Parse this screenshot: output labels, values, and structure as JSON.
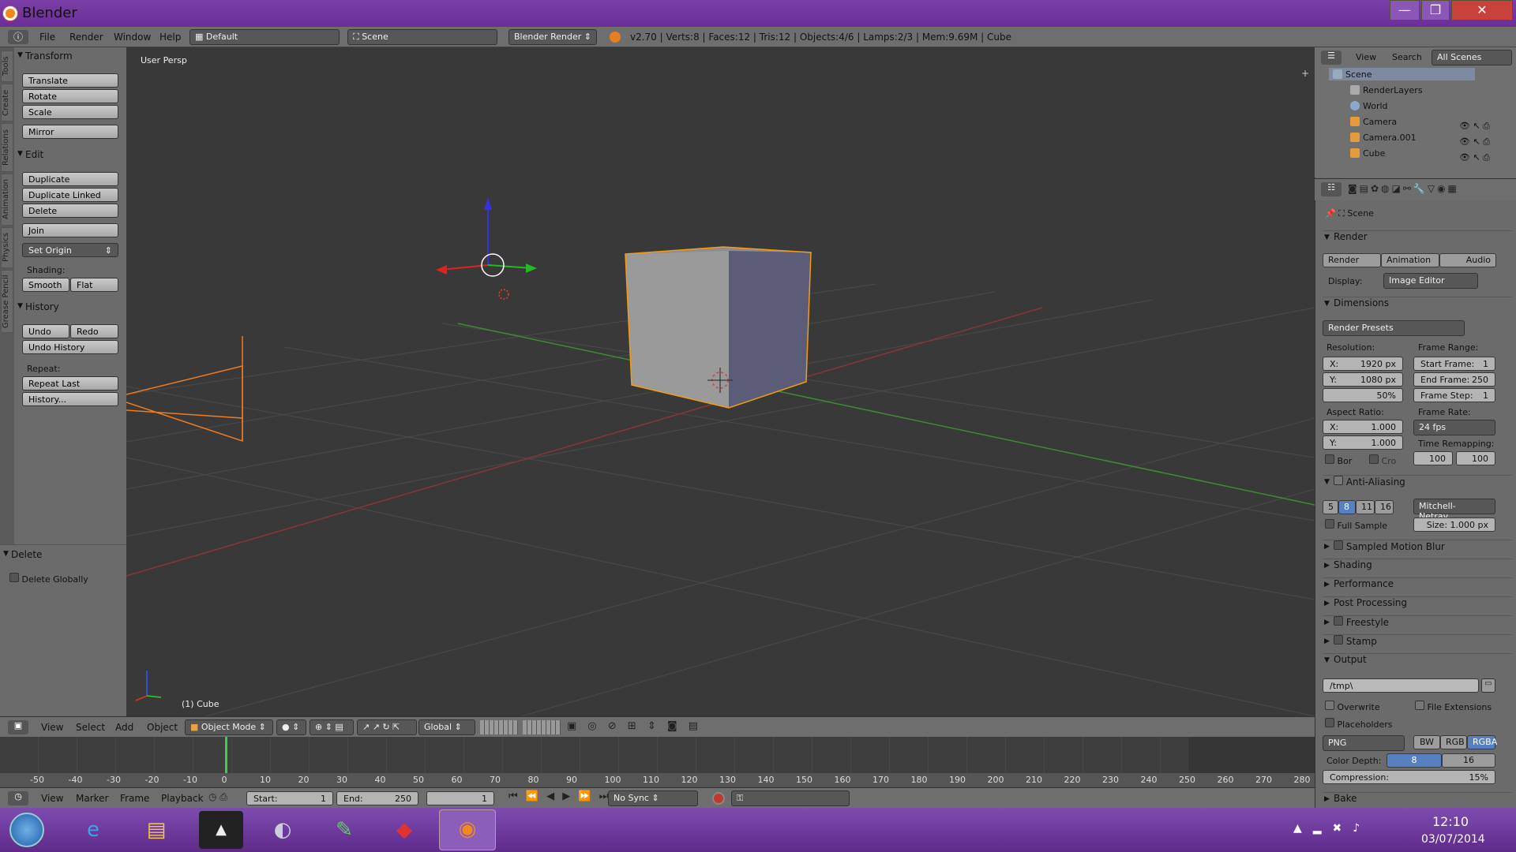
{
  "window": {
    "title": "Blender",
    "min": "—",
    "max": "❐",
    "close": "✕"
  },
  "info": {
    "menus": [
      "File",
      "Render",
      "Window",
      "Help"
    ],
    "screen_layout": "Default",
    "scene": "Scene",
    "engine": "Blender Render",
    "stats": "v2.70 | Verts:8 | Faces:12 | Tris:12 | Objects:4/6 | Lamps:2/3 | Mem:9.69M | Cube"
  },
  "tool_tabs": [
    "Tools",
    "Create",
    "Relations",
    "Animation",
    "Physics",
    "Grease Pencil"
  ],
  "toolshelf": {
    "transform": {
      "title": "Transform",
      "buttons": [
        "Translate",
        "Rotate",
        "Scale",
        "Mirror"
      ]
    },
    "edit": {
      "title": "Edit",
      "buttons": [
        "Duplicate",
        "Duplicate Linked",
        "Delete",
        "Join"
      ],
      "set_origin": "Set Origin",
      "shading_label": "Shading:",
      "smooth": "Smooth",
      "flat": "Flat"
    },
    "history": {
      "title": "History",
      "undo": "Undo",
      "redo": "Redo",
      "undo_history": "Undo History",
      "repeat_label": "Repeat:",
      "repeat_last": "Repeat Last",
      "history_btn": "History..."
    },
    "operator": {
      "title": "Delete",
      "delete_globally": "Delete Globally"
    }
  },
  "viewport": {
    "label": "User Persp",
    "object_label": "(1) Cube"
  },
  "vp_header": {
    "menus": [
      "View",
      "Select",
      "Add",
      "Object"
    ],
    "mode": "Object Mode",
    "orientation": "Global"
  },
  "timeline": {
    "ruler": [
      "-50",
      "-40",
      "-30",
      "-20",
      "-10",
      "0",
      "10",
      "20",
      "30",
      "40",
      "50",
      "60",
      "70",
      "80",
      "90",
      "100",
      "110",
      "120",
      "130",
      "140",
      "150",
      "160",
      "170",
      "180",
      "190",
      "200",
      "210",
      "220",
      "230",
      "240",
      "250",
      "260",
      "270",
      "280"
    ],
    "menus": [
      "View",
      "Marker",
      "Frame",
      "Playback"
    ],
    "start": "Start:",
    "start_val": "1",
    "end": "End:",
    "end_val": "250",
    "current": "1",
    "sync": "No Sync"
  },
  "outliner": {
    "menus": [
      "View",
      "Search"
    ],
    "filter": "All Scenes",
    "rows": [
      "Scene",
      "RenderLayers",
      "World",
      "Camera",
      "Camera.001",
      "Cube"
    ]
  },
  "properties": {
    "context": "Scene",
    "render": {
      "title": "Render",
      "render_btn": "Render",
      "animation_btn": "Animation",
      "audio_btn": "Audio",
      "display_label": "Display:",
      "display_val": "Image Editor"
    },
    "dimensions": {
      "title": "Dimensions",
      "presets": "Render Presets",
      "resolution_label": "Resolution:",
      "x": "X:",
      "x_val": "1920 px",
      "y": "Y:",
      "y_val": "1080 px",
      "percent": "50%",
      "frame_range_label": "Frame Range:",
      "start": "Start Frame:",
      "start_val": "1",
      "end": "End Frame:",
      "end_val": "250",
      "step": "Frame Step:",
      "step_val": "1",
      "aspect_label": "Aspect Ratio:",
      "ax_val": "1.000",
      "ay_val": "1.000",
      "framerate_label": "Frame Rate:",
      "fps": "24 fps",
      "remap_label": "Time Remapping:",
      "remap_old": "100",
      "remap_new": "100",
      "bor": "Bor",
      "cro": "Cro"
    },
    "aa": {
      "title": "Anti-Aliasing",
      "samples": [
        "5",
        "8",
        "11",
        "16"
      ],
      "filter": "Mitchell-Netrav...",
      "full_sample": "Full Sample",
      "size": "Size: 1.000 px"
    },
    "closed": [
      "Sampled Motion Blur",
      "Shading",
      "Performance",
      "Post Processing",
      "Freestyle",
      "Stamp"
    ],
    "output": {
      "title": "Output",
      "path": "/tmp\\",
      "overwrite": "Overwrite",
      "file_ext": "File Extensions",
      "placeholders": "Placeholders",
      "format": "PNG",
      "bw": "BW",
      "rgb": "RGB",
      "rgba": "RGBA",
      "depth_label": "Color Depth:",
      "d8": "8",
      "d16": "16",
      "compression": "Compression:",
      "comp_val": "15%"
    },
    "bake": "Bake"
  },
  "taskbar": {
    "time": "12:10",
    "date": "03/07/2014"
  }
}
